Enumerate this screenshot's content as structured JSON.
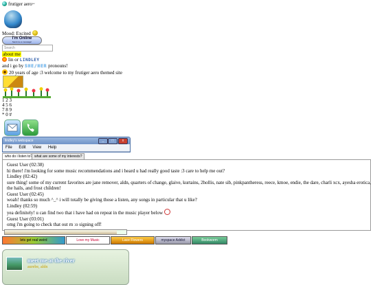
{
  "header": {
    "title": "frutiger aero~"
  },
  "profile": {
    "mood_label": "Mood: Excited",
    "online_badge": "I'm Online",
    "online_badge_sub": "Send me a message!",
    "search_placeholder": "Search",
    "about_heading": "about me",
    "name_prefix": "lin or",
    "name_pixel": "LINDLEY",
    "pronouns_prefix": "and i go by",
    "pronouns_pixel": "SHE/HER",
    "pronouns_suffix": "pronouns!",
    "bio": "20 years of age :3 welcome to my frutiger aero themed site",
    "keypad_lines": [
      "1 2 3",
      "4 5 6",
      "7 8 9",
      "* 0 #"
    ]
  },
  "window": {
    "title": "lindley's webspace",
    "menu": [
      "File",
      "Edit",
      "View",
      "Help"
    ],
    "tabs": [
      "who do i listen to?",
      "what are some of my interests?"
    ],
    "chat": [
      "Guest User (02:38)",
      "hi there! i'm looking for some music recommendations and i heard u had really good taste :3 care to help me out?",
      "Lindley (02:42)",
      "sure thing! some of my current favorites are jane remover, aldn, quarters of change, glaive, kurtains, 2hollis, nate sib, pinkpantheress, reece, kmoe, endie, the dare, charli xcx, ayesha erotica,",
      "the hails, and frost children!",
      "Guest User (02:45)",
      "woah! thanks so much ^_^ i will totally be giving those a listen, any songs in particular that u like?",
      "Lindley (02:59)",
      "yea definitely! u can find two that i have had on repeat in the music player below",
      "Guest User (03:01)",
      "omg i'm going to check that out rn :o signing off!"
    ],
    "window_buttons": [
      "_",
      "□",
      "x"
    ]
  },
  "player": {
    "progress": 0.92
  },
  "stamps": [
    "lets get real weird",
    "Love my Music",
    "Lace Flowers",
    "myspace Addict",
    "Bookworm"
  ],
  "card": {
    "title": "meet me at the river",
    "subtitle": "aurebe, aldn"
  },
  "colors": {
    "accent": "#4a6fa5",
    "highlight": "#ffff00",
    "card_title": "#ffffff"
  }
}
